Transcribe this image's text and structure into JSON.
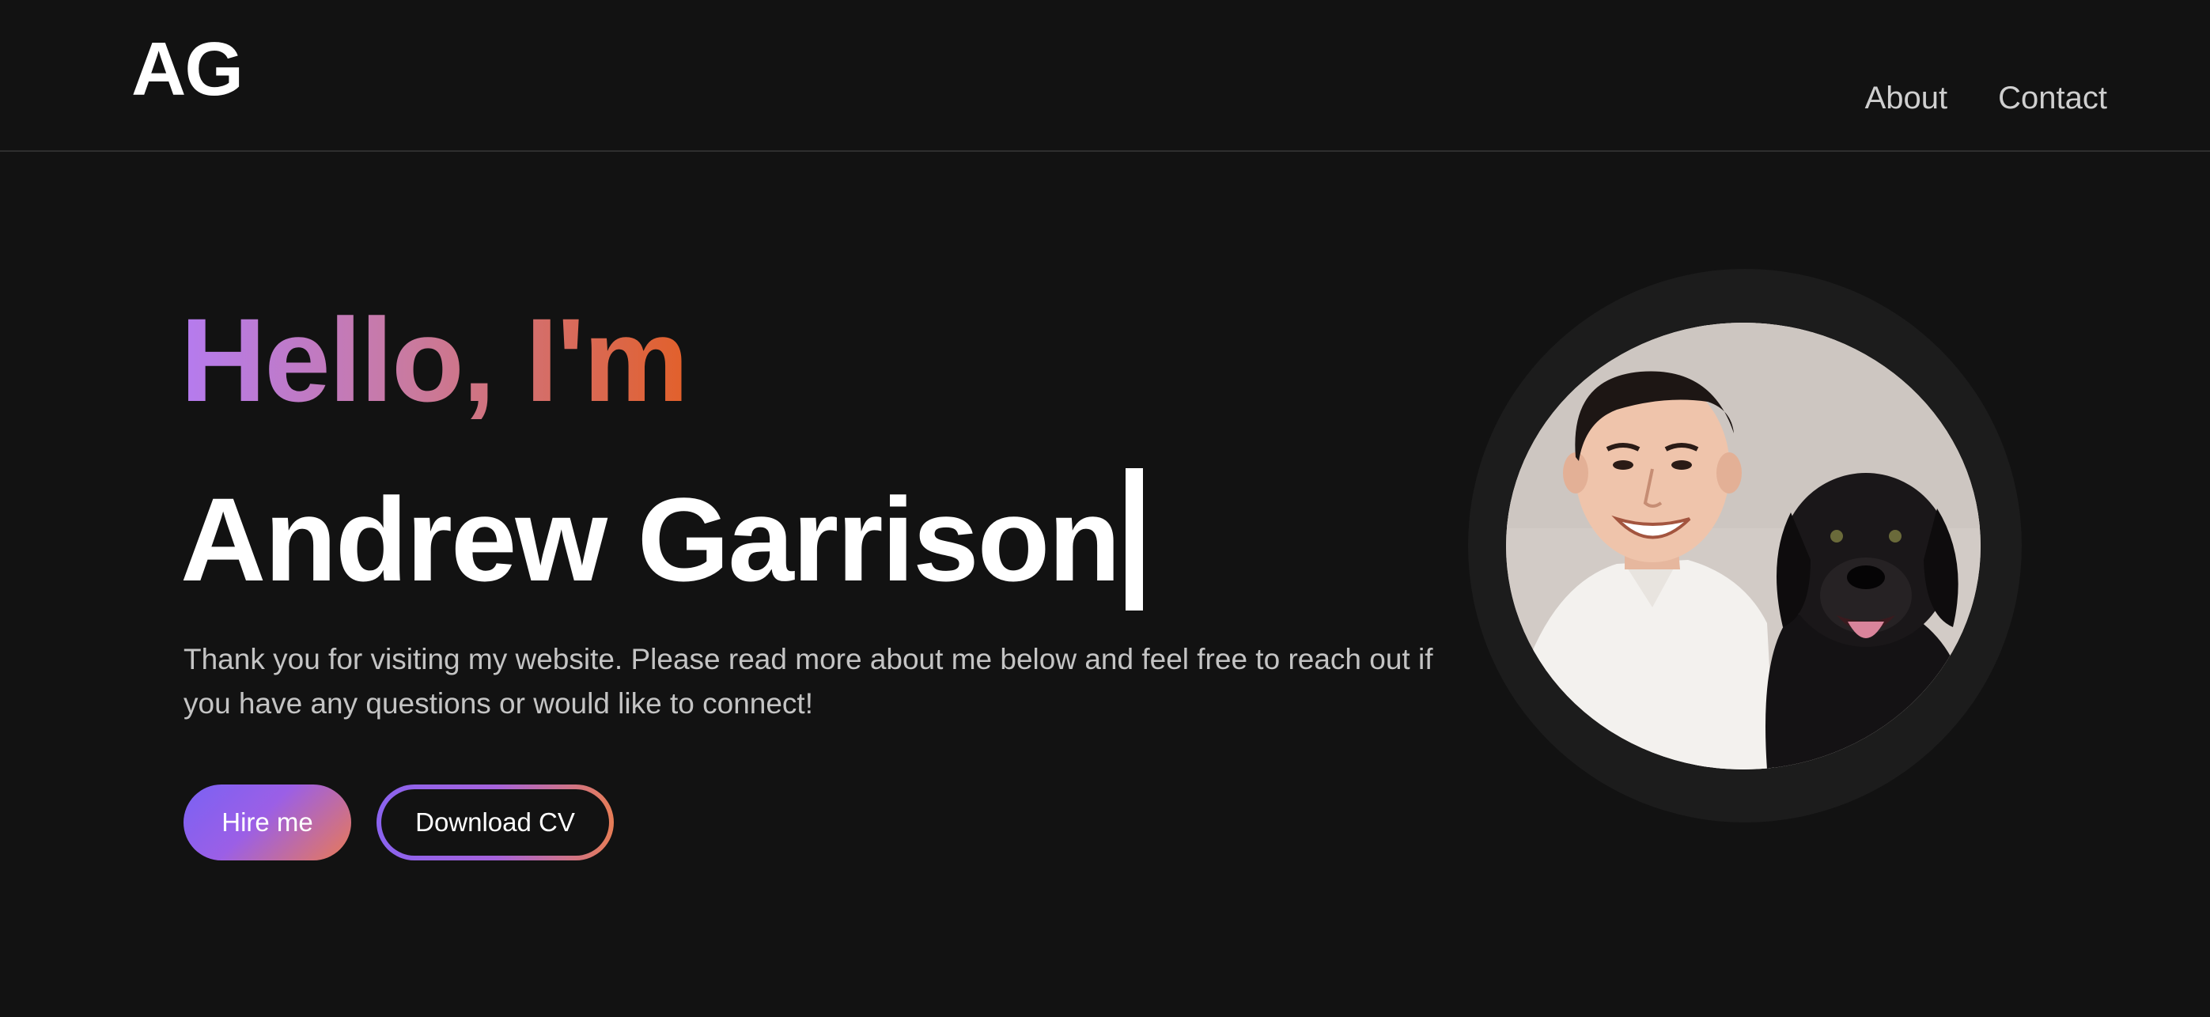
{
  "header": {
    "logo": "AG",
    "nav": [
      {
        "label": "About"
      },
      {
        "label": "Contact"
      }
    ]
  },
  "hero": {
    "greeting": "Hello, I'm",
    "name": "Andrew Garrison",
    "intro": "Thank you for visiting my website. Please read more about me below and feel free to reach out if you have any questions or would like to connect!",
    "hire_label": "Hire me",
    "cv_label": "Download CV"
  },
  "colors": {
    "background": "#121212",
    "greeting_gradient": [
      "#b57bf0",
      "#e2602a"
    ],
    "button_gradient": [
      "#7a62f4",
      "#e97a55"
    ]
  },
  "portrait": {
    "subject": "man-with-black-dog-photo"
  }
}
